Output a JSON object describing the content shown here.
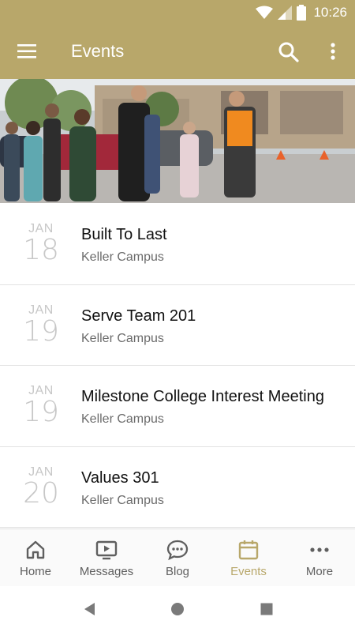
{
  "status_bar": {
    "time": "10:26"
  },
  "app_bar": {
    "title": "Events"
  },
  "events": [
    {
      "month": "JAN",
      "day": "18",
      "name": "Built To Last",
      "campus": "Keller Campus"
    },
    {
      "month": "JAN",
      "day": "19",
      "name": "Serve Team 201",
      "campus": "Keller Campus"
    },
    {
      "month": "JAN",
      "day": "19",
      "name": "Milestone College Interest Meeting",
      "campus": "Keller Campus"
    },
    {
      "month": "JAN",
      "day": "20",
      "name": "Values 301",
      "campus": "Keller Campus"
    }
  ],
  "bottom_nav": {
    "items": [
      {
        "label": "Home",
        "icon": "home-icon"
      },
      {
        "label": "Messages",
        "icon": "video-icon"
      },
      {
        "label": "Blog",
        "icon": "chat-icon"
      },
      {
        "label": "Events",
        "icon": "calendar-icon",
        "active": true
      },
      {
        "label": "More",
        "icon": "more-horizontal-icon"
      }
    ]
  },
  "colors": {
    "accent": "#b8a76a",
    "text_primary": "#111111",
    "text_secondary": "#6b6b6b",
    "date_gray": "#c7c7c7"
  }
}
